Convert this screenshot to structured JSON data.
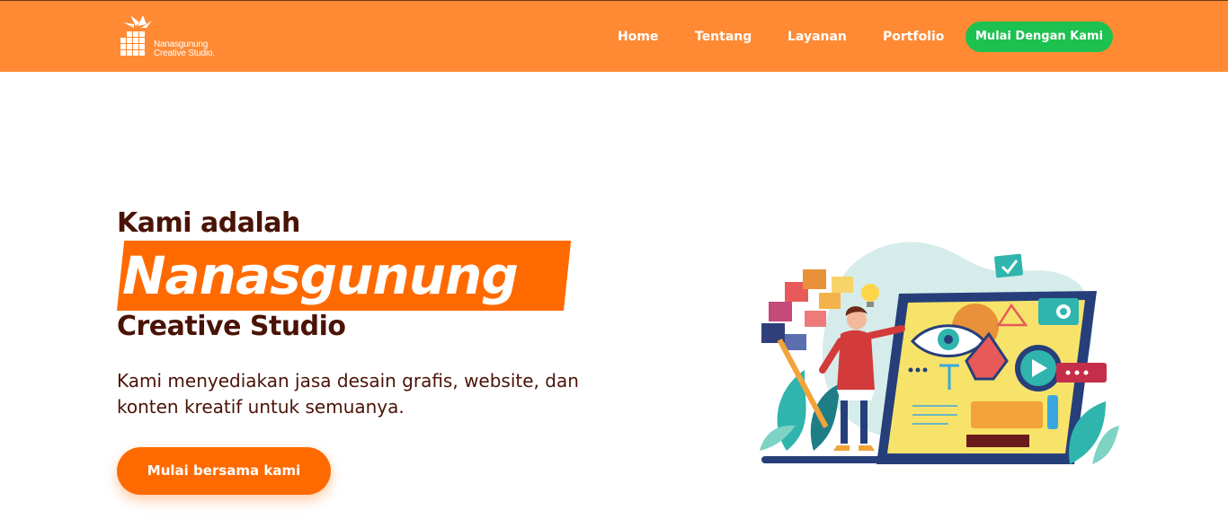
{
  "brand": {
    "name_line1": "Nanasgunung",
    "name_line2": "Creative Studio.",
    "logo_icon": "pineapple-grid-icon"
  },
  "nav": {
    "items": [
      {
        "label": "Home"
      },
      {
        "label": "Tentang"
      },
      {
        "label": "Layanan"
      },
      {
        "label": "Portfolio"
      }
    ],
    "cta_label": "Mulai Dengan Kami"
  },
  "hero": {
    "pre_title": "Kami adalah",
    "highlight": "Nanasgunung",
    "post_title": "Creative Studio",
    "description": "Kami menyediakan jasa desain grafis, website, dan konten kreatif untuk semuanya.",
    "cta_label": "Mulai bersama kami",
    "illustration": "designer-tablet-illustration"
  },
  "colors": {
    "navbar": "#ff8a33",
    "accent": "#ff6a00",
    "cta_green": "#1cc14f",
    "heading": "#4a1306"
  }
}
